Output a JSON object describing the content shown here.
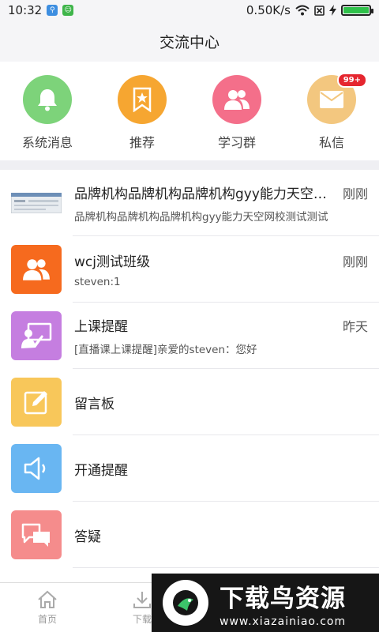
{
  "status_bar": {
    "time": "10:32",
    "speed": "0.50K/s"
  },
  "header": {
    "title": "交流中心"
  },
  "quick_actions": [
    {
      "label": "系统消息",
      "icon": "bell-icon",
      "color": "#7dd37a"
    },
    {
      "label": "推荐",
      "icon": "bookmark-star-icon",
      "color": "#f6a631"
    },
    {
      "label": "学习群",
      "icon": "group-icon",
      "color": "#f46f8a"
    },
    {
      "label": "私信",
      "icon": "envelope-icon",
      "color": "#f3c77f",
      "badge": "99+"
    }
  ],
  "conversations": [
    {
      "title": "品牌机构品牌机构品牌机构gyy能力天空网校",
      "subtitle": "品牌机构品牌机构品牌机构gyy能力天空网校测试测试",
      "time": "刚刚",
      "icon": "thumbnail-image"
    },
    {
      "title": "wcj测试班级",
      "subtitle": "steven:1",
      "time": "刚刚",
      "icon": "group-icon",
      "color": "#f66a1e"
    },
    {
      "title": "上课提醒",
      "subtitle": "[直播课上课提醒]亲爱的steven：您好",
      "time": "昨天",
      "icon": "teacher-board-icon",
      "color": "#c57ee0"
    },
    {
      "title": "留言板",
      "subtitle": "",
      "time": "",
      "icon": "edit-note-icon",
      "color": "#f8c75a"
    },
    {
      "title": "开通提醒",
      "subtitle": "",
      "time": "",
      "icon": "speaker-icon",
      "color": "#69b6f2"
    },
    {
      "title": "答疑",
      "subtitle": "",
      "time": "",
      "icon": "chat-bubbles-icon",
      "color": "#f58c8c"
    }
  ],
  "tabbar": [
    {
      "label": "首页",
      "icon": "home-icon"
    },
    {
      "label": "下载",
      "icon": "download-icon"
    }
  ],
  "watermark": {
    "text": "下载鸟资源",
    "url": "www.xiazainiao.com"
  }
}
